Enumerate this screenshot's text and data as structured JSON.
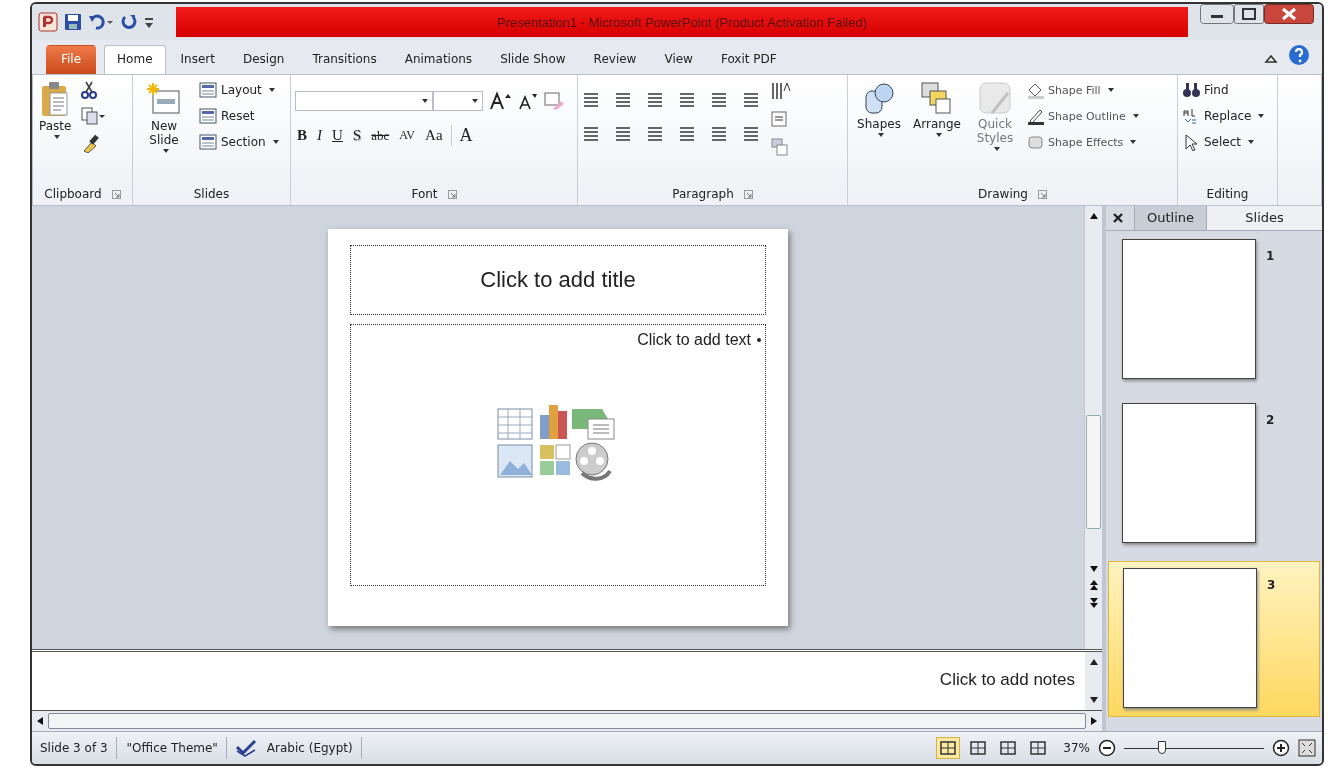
{
  "window": {
    "title": "Presentation1  -  Microsoft PowerPoint (Product Activation Failed)"
  },
  "tabs": [
    {
      "label": "File",
      "kind": "file",
      "selected": false
    },
    {
      "label": "Home",
      "kind": "tab",
      "selected": true
    },
    {
      "label": "Insert",
      "kind": "tab",
      "selected": false
    },
    {
      "label": "Design",
      "kind": "tab",
      "selected": false
    },
    {
      "label": "Transitions",
      "kind": "tab",
      "selected": false
    },
    {
      "label": "Animations",
      "kind": "tab",
      "selected": false
    },
    {
      "label": "Slide Show",
      "kind": "tab",
      "selected": false
    },
    {
      "label": "Review",
      "kind": "tab",
      "selected": false
    },
    {
      "label": "View",
      "kind": "tab",
      "selected": false
    },
    {
      "label": "Foxit PDF",
      "kind": "tab",
      "selected": false
    }
  ],
  "ribbon": [
    {
      "kind": "clipboard",
      "name": "Clipboard",
      "paste": "Paste"
    },
    {
      "kind": "slides",
      "name": "Slides",
      "new_slide": "New Slide",
      "items": [
        "Layout",
        "Reset",
        "Section"
      ]
    },
    {
      "kind": "font",
      "name": "Font",
      "format_buttons": [
        "B",
        "I",
        "U",
        "S",
        "abc",
        "AV",
        "Aa",
        "A"
      ]
    },
    {
      "kind": "paragraph",
      "name": "Paragraph"
    },
    {
      "kind": "drawing",
      "name": "Drawing",
      "big": [
        {
          "label": "Shapes",
          "disabled": false
        },
        {
          "label": "Arrange",
          "disabled": false
        },
        {
          "label": "Quick Styles",
          "disabled": true
        }
      ],
      "items": [
        "Shape Fill",
        "Shape Outline",
        "Shape Effects"
      ]
    },
    {
      "kind": "editing",
      "name": "Editing",
      "items": [
        "Find",
        "Replace",
        "Select"
      ]
    }
  ],
  "slide": {
    "title_placeholder": "Click to add title",
    "text_placeholder": "Click to add text"
  },
  "notes": {
    "placeholder": "Click to add notes"
  },
  "pane": {
    "tabs": [
      {
        "label": "Outline",
        "selected": false
      },
      {
        "label": "Slides",
        "selected": true
      }
    ],
    "thumbnails": [
      {
        "number": "1",
        "selected": false
      },
      {
        "number": "2",
        "selected": false
      },
      {
        "number": "3",
        "selected": true
      }
    ]
  },
  "status_bar": {
    "items": [
      "Slide 3 of 3",
      "\"Office Theme\"",
      "Arabic (Egypt)"
    ],
    "views": [
      {
        "selected": true
      },
      {
        "selected": false
      },
      {
        "selected": false
      },
      {
        "selected": false
      }
    ],
    "zoom": "37%",
    "zoom_slider": {
      "level": 0.27
    }
  }
}
